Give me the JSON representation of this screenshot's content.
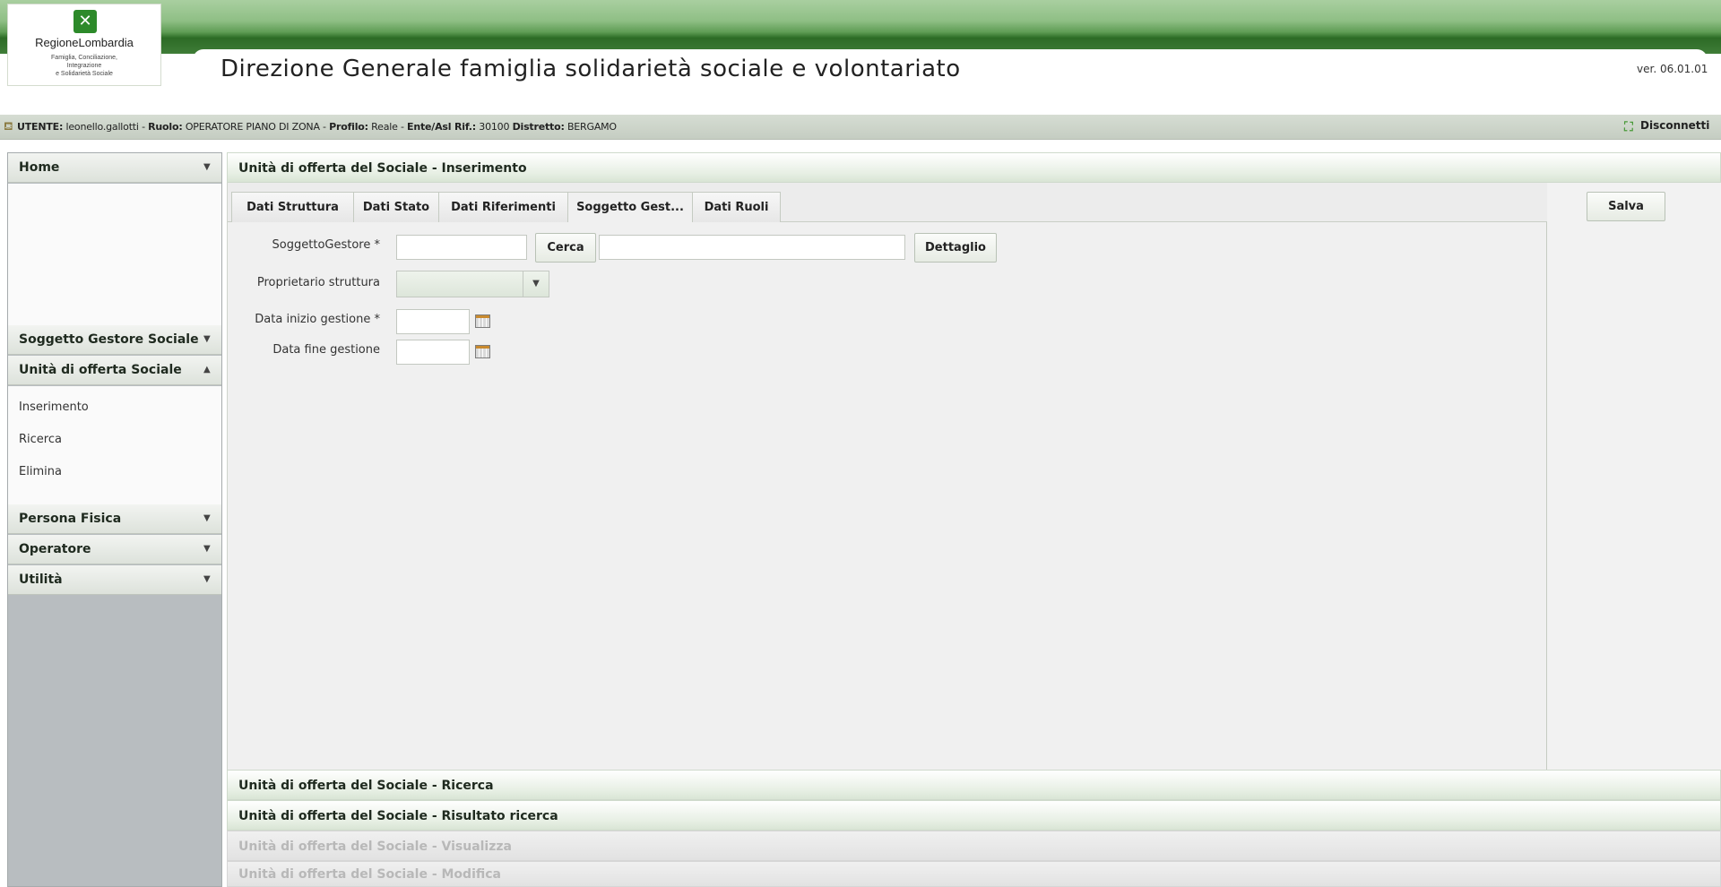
{
  "header": {
    "logo_name": "RegioneLombardia",
    "logo_sub": [
      "Famiglia, Conciliazione,",
      "Integrazione",
      "e Solidarietà Sociale"
    ],
    "title": "Direzione Generale famiglia solidarietà sociale e volontariato",
    "version": "ver. 06.01.01",
    "brand_color": "#2d8a2a"
  },
  "userbar": {
    "utente_label": "UTENTE:",
    "utente": "leonello.gallotti",
    "ruolo_label": "Ruolo:",
    "ruolo": "OPERATORE PIANO DI ZONA",
    "profilo_label": "Profilo:",
    "profilo": "Reale",
    "ente_label": "Ente/Asl Rif.:",
    "ente": "30100",
    "distretto_label": "Distretto:",
    "distretto": "BERGAMO",
    "sep": " - ",
    "logout_label": "Disconnetti"
  },
  "sidebar": {
    "home": "Home",
    "soggetto_gestore": "Soggetto Gestore Sociale",
    "unita_offerta": "Unità di offerta Sociale",
    "links": [
      "Inserimento",
      "Ricerca",
      "Elimina"
    ],
    "persona_fisica": "Persona Fisica",
    "operatore": "Operatore",
    "utilita": "Utilità"
  },
  "main": {
    "sections": [
      "Unità di offerta del Sociale - Inserimento",
      "Unità di offerta del Sociale - Ricerca",
      "Unità di offerta del Sociale - Risultato ricerca",
      "Unità di offerta del Sociale - Visualizza",
      "Unità di offerta del Sociale - Modifica"
    ],
    "tabs": [
      "Dati Struttura",
      "Dati Stato",
      "Dati Riferimenti",
      "Soggetto Gest...",
      "Dati Ruoli"
    ],
    "active_tab": "Soggetto Gest...",
    "save_label": "Salva",
    "form": {
      "soggetto_label": "SoggettoGestore *",
      "soggetto_value": "",
      "cerca_label": "Cerca",
      "soggetto_desc": "",
      "dettaglio_label": "Dettaglio",
      "proprietario_label": "Proprietario struttura",
      "proprietario_value": "",
      "data_inizio_label": "Data inizio gestione *",
      "data_inizio_value": "",
      "data_fine_label": "Data fine gestione",
      "data_fine_value": ""
    }
  }
}
